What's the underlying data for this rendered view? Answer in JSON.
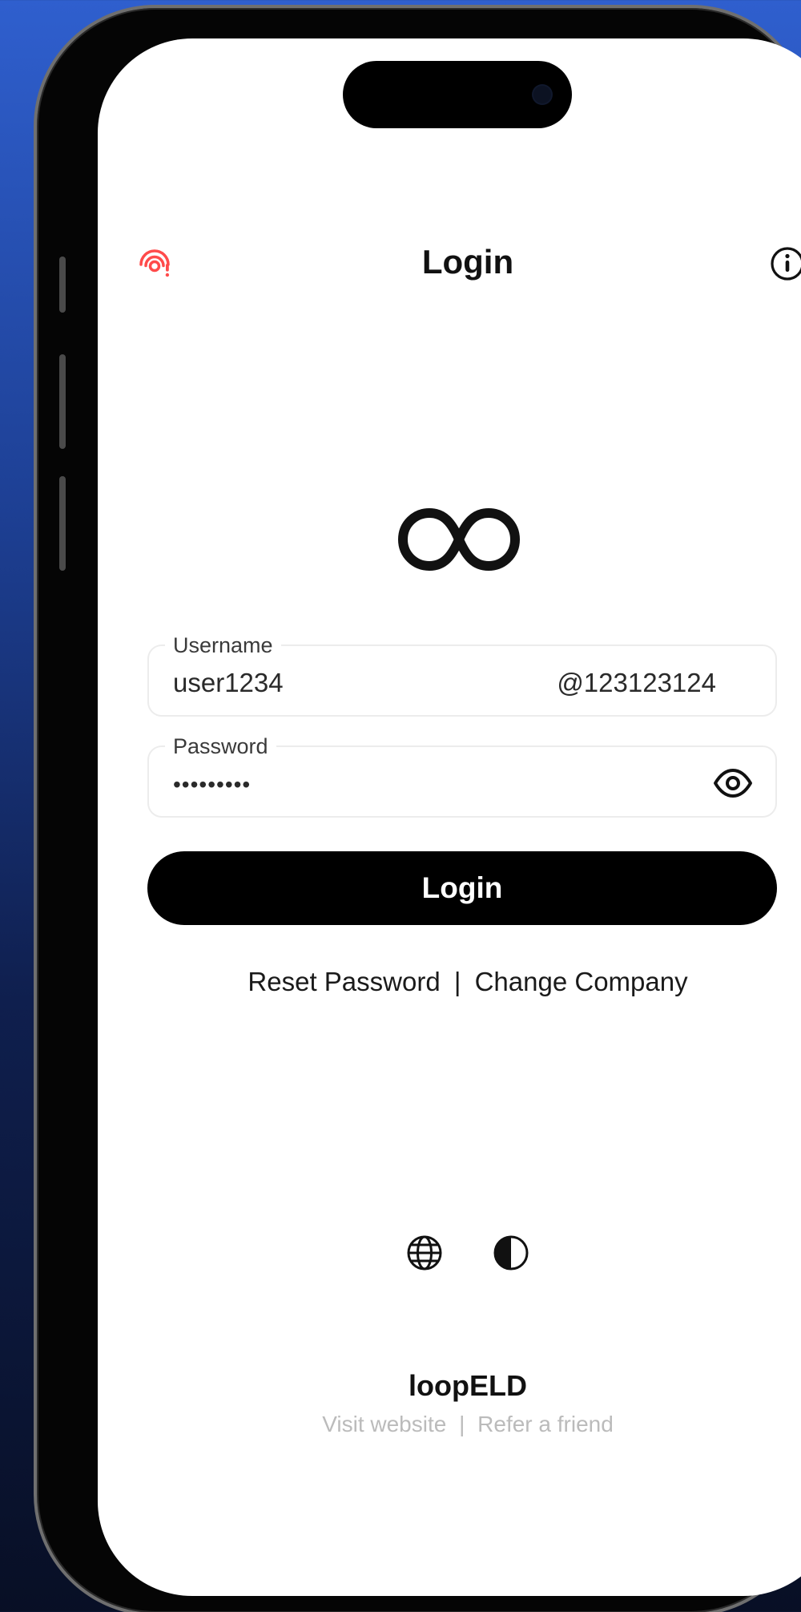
{
  "header": {
    "title": "Login",
    "left_icon": "connection-alert-icon",
    "right_icon": "info-icon",
    "left_icon_color": "#ff4b4b"
  },
  "logo": {
    "icon": "infinity-logo-icon"
  },
  "form": {
    "username": {
      "label": "Username",
      "value": "user1234",
      "suffix": "@123123124"
    },
    "password": {
      "label": "Password",
      "value": "•••••••••",
      "toggle_icon": "eye-icon"
    },
    "login_button_label": "Login"
  },
  "links": {
    "reset_password": "Reset Password",
    "separator": "|",
    "change_company": "Change Company"
  },
  "quick_actions": {
    "language_icon": "globe-icon",
    "theme_icon": "contrast-icon"
  },
  "footer": {
    "brand": "loopELD",
    "visit_website": "Visit website",
    "separator": "|",
    "refer_friend": "Refer a friend"
  }
}
